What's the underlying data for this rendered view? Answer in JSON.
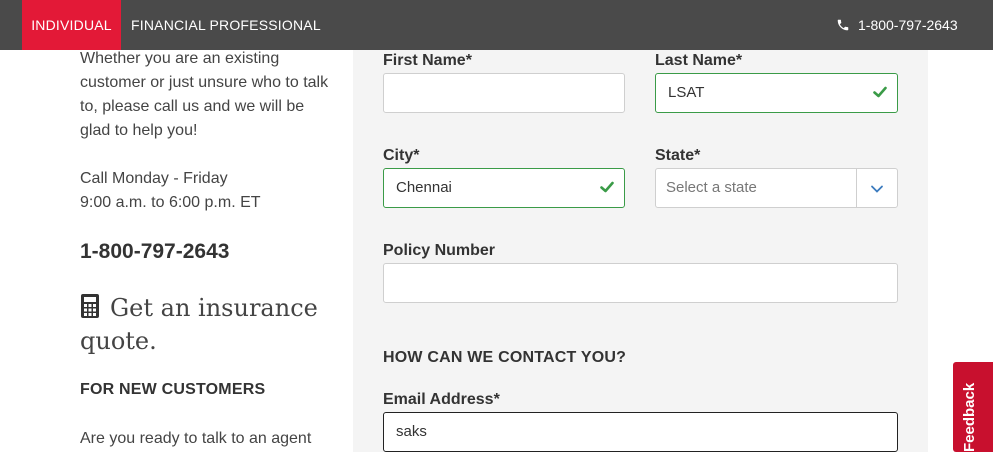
{
  "topbar": {
    "tab_individual": "INDIVIDUAL",
    "tab_financial": "FINANCIAL PROFESSIONAL",
    "phone": "1-800-797-2643",
    "phone_icon": "phone-icon",
    "background": "#4a4a4a",
    "accent": "#e31937"
  },
  "sidebar": {
    "intro": "Whether you are an existing customer or just unsure who to talk to, please call us and we will be glad to help you!",
    "hours_days": "Call Monday - Friday",
    "hours_time": "9:00 a.m. to 6:00 p.m. ET",
    "phone": "1-800-797-2643",
    "quote_title": "Get an insurance quote.",
    "quote_icon": "calculator-icon",
    "new_customers_heading": "FOR NEW CUSTOMERS",
    "agent_text": "Are you ready to talk to an agent"
  },
  "form": {
    "first_name": {
      "label": "First Name*",
      "value": ""
    },
    "last_name": {
      "label": "Last Name*",
      "value": "LSAT"
    },
    "city": {
      "label": "City*",
      "value": "Chennai"
    },
    "state": {
      "label": "State*",
      "placeholder": "Select a state"
    },
    "policy_number": {
      "label": "Policy Number",
      "value": ""
    },
    "contact_heading": "HOW CAN WE CONTACT YOU?",
    "email": {
      "label": "Email Address*",
      "value": "saks"
    },
    "valid_color": "#3a9b47"
  },
  "feedback": {
    "label": "Feedback",
    "color": "#c8102e"
  }
}
